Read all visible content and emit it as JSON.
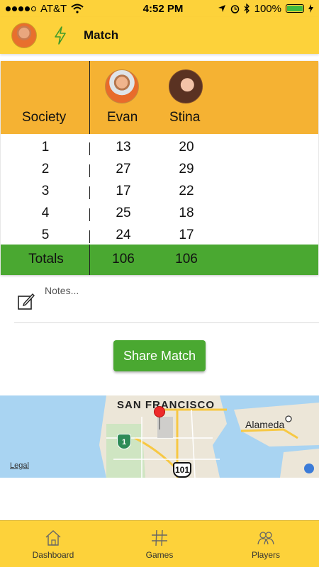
{
  "status_bar": {
    "carrier": "AT&T",
    "time": "4:52 PM",
    "battery_percent": "100%",
    "battery_level": 1.0,
    "signal_bars_filled": 4
  },
  "header": {
    "title": "Match"
  },
  "scorecard": {
    "label_column_header": "Society",
    "players": [
      {
        "name": "Evan"
      },
      {
        "name": "Stina"
      }
    ],
    "rows": [
      {
        "hole": "1",
        "scores": [
          "13",
          "20"
        ]
      },
      {
        "hole": "2",
        "scores": [
          "27",
          "29"
        ]
      },
      {
        "hole": "3",
        "scores": [
          "17",
          "22"
        ]
      },
      {
        "hole": "4",
        "scores": [
          "25",
          "18"
        ]
      },
      {
        "hole": "5",
        "scores": [
          "24",
          "17"
        ]
      }
    ],
    "totals_label": "Totals",
    "totals": [
      "106",
      "106"
    ]
  },
  "notes": {
    "placeholder": "Notes..."
  },
  "share_button": {
    "label": "Share Match"
  },
  "map": {
    "city_main": "SAN FRANCISCO",
    "city_secondary": "Alameda",
    "route_shield_state": "1",
    "route_shield_us": "101",
    "legal_label": "Legal"
  },
  "tabs": [
    {
      "label": "Dashboard",
      "icon": "home-icon"
    },
    {
      "label": "Games",
      "icon": "hashtag-icon"
    },
    {
      "label": "Players",
      "icon": "players-icon"
    }
  ],
  "colors": {
    "header_yellow": "#fdd23a",
    "table_header_orange": "#f5b233",
    "totals_green": "#4aa831",
    "button_green": "#4aa831"
  }
}
